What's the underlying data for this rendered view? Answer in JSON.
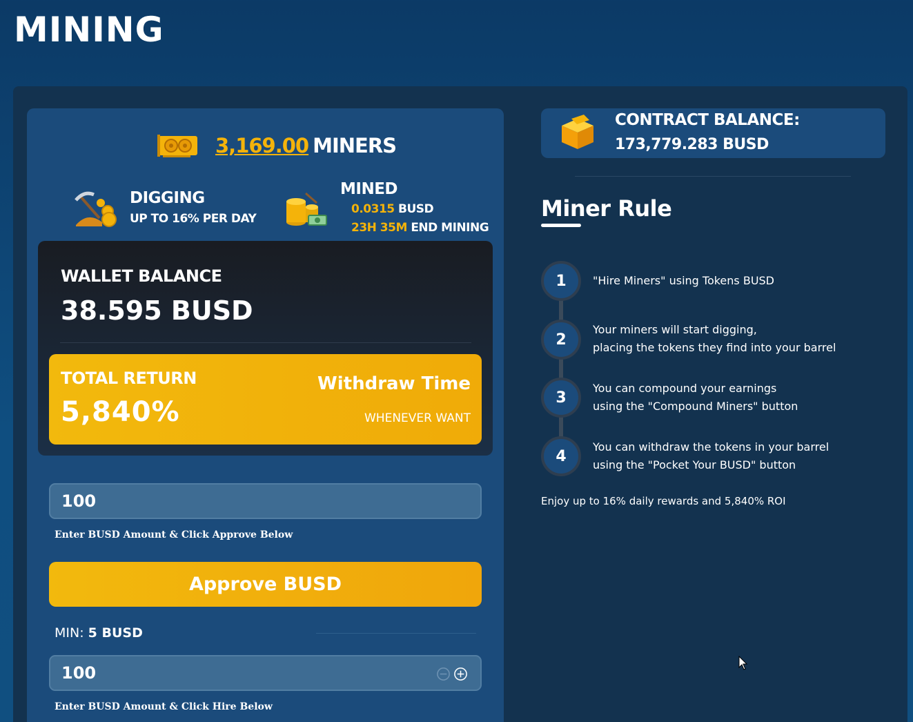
{
  "page": {
    "title": "MINING"
  },
  "miners": {
    "count": "3,169.00",
    "label": "MINERS"
  },
  "digging": {
    "title": "DIGGING",
    "subtitle": "UP TO 16% PER DAY"
  },
  "mined": {
    "title": "MINED",
    "amount": "0.0315",
    "amount_unit": "BUSD",
    "time": "23H 35M",
    "time_label": "END MINING"
  },
  "wallet": {
    "label": "WALLET BALANCE",
    "value": "38.595 BUSD"
  },
  "return": {
    "label": "TOTAL RETURN",
    "value": "5,840%",
    "withdraw_label": "Withdraw Time",
    "withdraw_value": "WHENEVER WANT"
  },
  "approve_form": {
    "input_value": "100",
    "hint": "Enter BUSD Amount & Click Approve Below",
    "button_label": "Approve BUSD"
  },
  "min": {
    "label": "MIN:",
    "value": "5 BUSD"
  },
  "hire_form": {
    "input_value": "100",
    "hint": "Enter BUSD Amount & Click Hire Below"
  },
  "contract": {
    "label": "CONTRACT BALANCE:",
    "value": "173,779.283 BUSD"
  },
  "rules": {
    "title": "Miner Rule",
    "steps": [
      {
        "number": "1",
        "line1": "\"Hire Miners\" using Tokens BUSD",
        "line2": ""
      },
      {
        "number": "2",
        "line1": "Your miners will start digging,",
        "line2": "placing the tokens they find into your barrel"
      },
      {
        "number": "3",
        "line1": "You can compound your earnings",
        "line2": "using the \"Compound Miners\" button"
      },
      {
        "number": "4",
        "line1": "You can withdraw the tokens in your barrel",
        "line2": "using the \"Pocket Your BUSD\" button"
      }
    ],
    "footer": "Enjoy up to 16% daily rewards and 5,840% ROI"
  },
  "colors": {
    "accent": "#f4b30a",
    "card": "#1b4b7b",
    "panel": "#13324f"
  },
  "icons": [
    "gpu-icon",
    "pickaxe-coins-icon",
    "coin-stack-icon",
    "crypto-box-icon",
    "minus-circle-icon",
    "plus-circle-icon",
    "mouse-cursor-icon"
  ]
}
